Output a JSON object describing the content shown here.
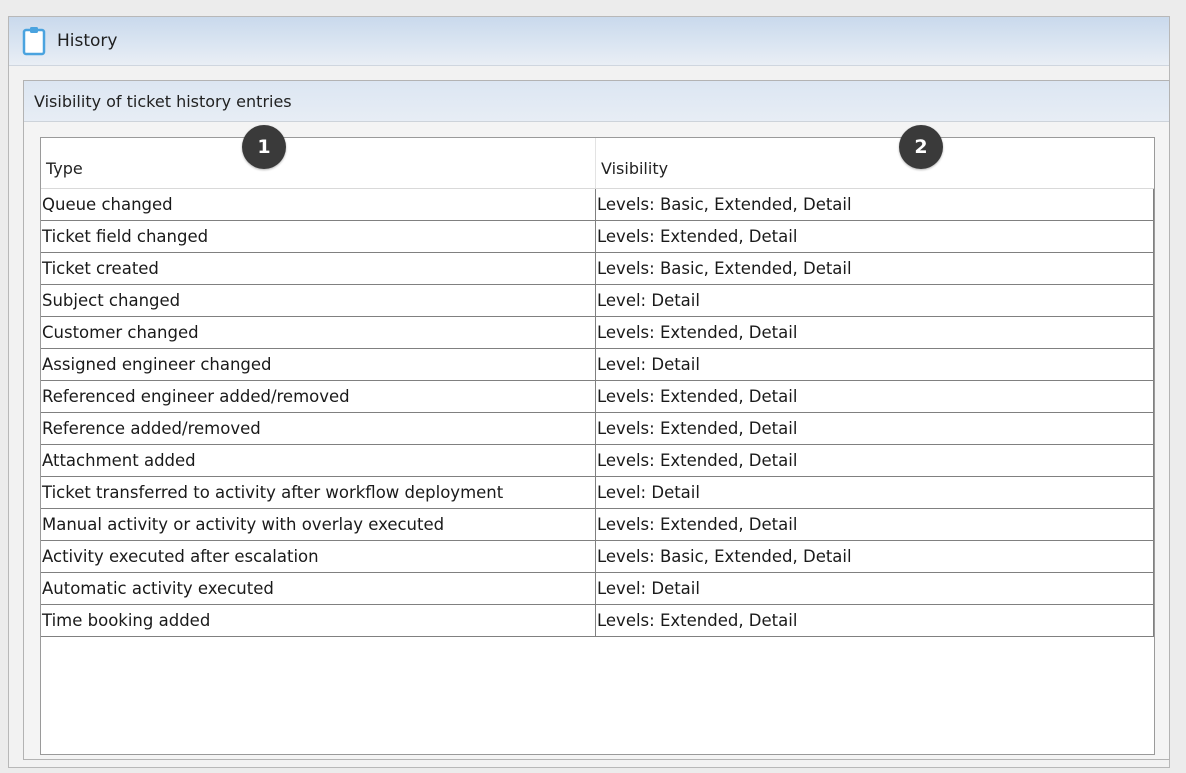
{
  "window": {
    "title": "History",
    "icon": "clipboard-icon"
  },
  "group": {
    "header": "Visibility of ticket history entries"
  },
  "table": {
    "columns": [
      "Type",
      "Visibility"
    ],
    "callouts": [
      "1",
      "2"
    ],
    "rows": [
      {
        "type": "Queue changed",
        "visibility": "Levels: Basic, Extended, Detail"
      },
      {
        "type": "Ticket field changed",
        "visibility": "Levels: Extended, Detail"
      },
      {
        "type": "Ticket created",
        "visibility": "Levels: Basic, Extended, Detail"
      },
      {
        "type": "Subject changed",
        "visibility": "Level: Detail"
      },
      {
        "type": "Customer changed",
        "visibility": "Levels: Extended, Detail"
      },
      {
        "type": "Assigned engineer changed",
        "visibility": "Level: Detail"
      },
      {
        "type": "Referenced engineer added/removed",
        "visibility": "Levels: Extended, Detail"
      },
      {
        "type": "Reference added/removed",
        "visibility": "Levels: Extended, Detail"
      },
      {
        "type": "Attachment added",
        "visibility": "Levels: Extended, Detail"
      },
      {
        "type": "Ticket transferred to activity after workflow deployment",
        "visibility": "Level: Detail"
      },
      {
        "type": "Manual activity or activity with overlay executed",
        "visibility": "Levels: Extended, Detail"
      },
      {
        "type": "Activity executed after escalation",
        "visibility": "Levels: Basic, Extended, Detail"
      },
      {
        "type": "Automatic activity executed",
        "visibility": "Level: Detail"
      },
      {
        "type": "Time booking added",
        "visibility": "Levels: Extended, Detail"
      }
    ]
  },
  "colors": {
    "title_gradient": "#c9d9ec",
    "icon_blue": "#4aa3df",
    "badge": "#3a3a3a"
  }
}
